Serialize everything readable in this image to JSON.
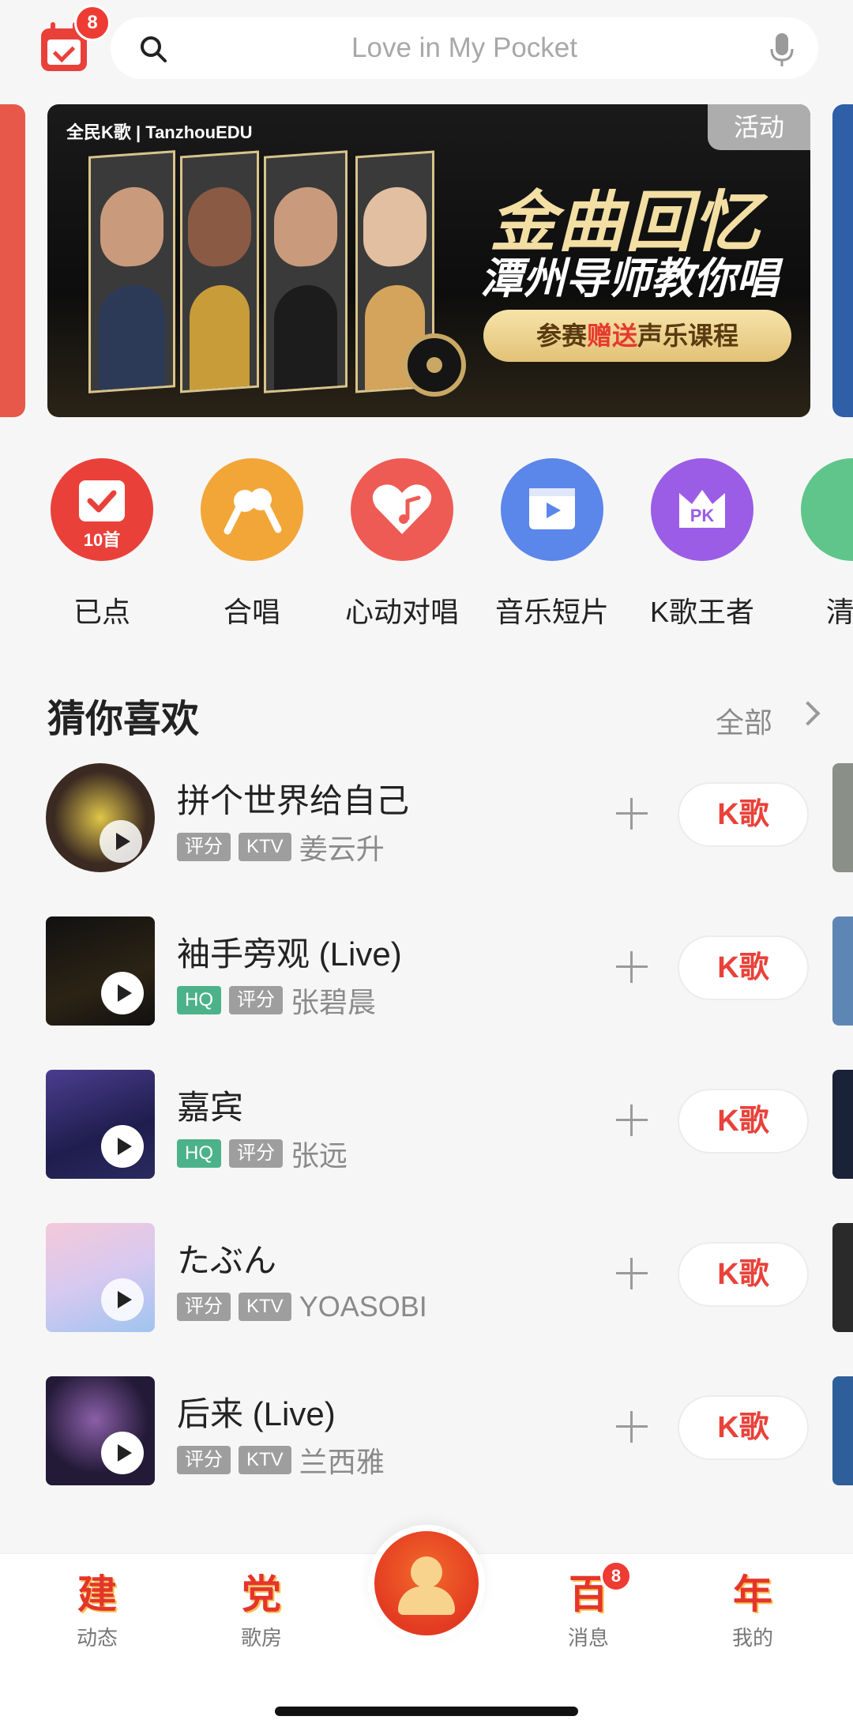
{
  "header": {
    "calendar_badge": "8",
    "search_placeholder": "Love in My Pocket"
  },
  "banner": {
    "logo_text": "全民K歌 | TanzhouEDU",
    "tag": "活动",
    "title_line1": "金曲回忆",
    "title_line2": "潭州导师教你唱",
    "pill_prefix": "参赛",
    "pill_highlight": "赠送",
    "pill_suffix": "声乐课程"
  },
  "quick_nav": [
    {
      "label": "已点",
      "sub": "10首",
      "color": "#e9413a",
      "icon": "checklist-icon"
    },
    {
      "label": "合唱",
      "color": "#f2a638",
      "icon": "duet-mic-icon"
    },
    {
      "label": "心动对唱",
      "color": "#ee5b54",
      "icon": "heart-music-icon"
    },
    {
      "label": "音乐短片",
      "color": "#5b86ea",
      "icon": "video-clip-icon"
    },
    {
      "label": "K歌王者",
      "color": "#9b5de5",
      "icon": "pk-crown-icon"
    },
    {
      "label": "清",
      "color": "#5fc58a",
      "icon": "clear-icon"
    }
  ],
  "section": {
    "title": "猜你喜欢",
    "more": "全部"
  },
  "songs": [
    {
      "title": "拼个世界给自己",
      "tags": [
        "评分",
        "KTV"
      ],
      "tag_styles": [
        "gray",
        "gray"
      ],
      "artist": "姜云升",
      "button": "K歌",
      "cover": "#3b2a22",
      "round": true
    },
    {
      "title": "袖手旁观 (Live)",
      "tags": [
        "HQ",
        "评分"
      ],
      "tag_styles": [
        "green",
        "gray"
      ],
      "artist": "张碧晨",
      "button": "K歌",
      "cover": "#1b1b1b",
      "round": false
    },
    {
      "title": "嘉宾",
      "tags": [
        "HQ",
        "评分"
      ],
      "tag_styles": [
        "green",
        "gray"
      ],
      "artist": "张远",
      "button": "K歌",
      "cover": "#2a2b5e",
      "round": false
    },
    {
      "title": "たぶん",
      "tags": [
        "评分",
        "KTV"
      ],
      "tag_styles": [
        "gray",
        "gray"
      ],
      "artist": "YOASOBI",
      "button": "K歌",
      "cover": "#d7c9f0",
      "round": false
    },
    {
      "title": "后来 (Live)",
      "tags": [
        "评分",
        "KTV"
      ],
      "tag_styles": [
        "gray",
        "gray"
      ],
      "artist": "兰西雅",
      "button": "K歌",
      "cover": "#231a38",
      "round": false
    }
  ],
  "tabbar": {
    "tabs": [
      {
        "glyph": "建",
        "label": "动态"
      },
      {
        "glyph": "党",
        "label": "歌房"
      },
      {
        "glyph": "百",
        "label": "消息",
        "badge": "8"
      },
      {
        "glyph": "年",
        "label": "我的"
      }
    ]
  },
  "colors": {
    "accent": "#e8423a",
    "badge": "#ee3b34",
    "hq_tag": "#4cb28a"
  }
}
